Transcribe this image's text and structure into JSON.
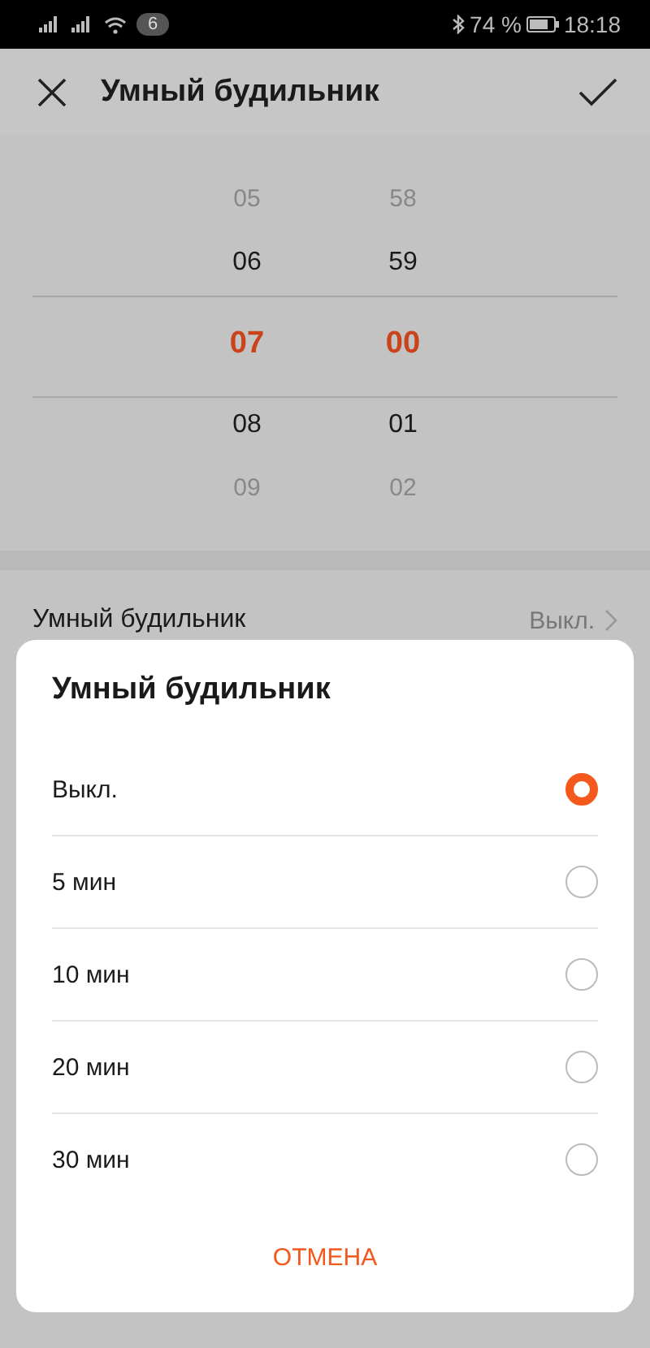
{
  "status_bar": {
    "notifications": "6",
    "battery": "74 %",
    "time": "18:18"
  },
  "header": {
    "title": "Умный будильник"
  },
  "picker": {
    "columns": [
      {
        "items": [
          {
            "text": "05",
            "selected": false,
            "faded": true
          },
          {
            "text": "06",
            "selected": false,
            "faded": false
          },
          {
            "text": "07",
            "selected": true,
            "faded": false
          },
          {
            "text": "08",
            "selected": false,
            "faded": false
          },
          {
            "text": "09",
            "selected": false,
            "faded": true
          }
        ]
      },
      {
        "items": [
          {
            "text": "58",
            "selected": false,
            "faded": true
          },
          {
            "text": "59",
            "selected": false,
            "faded": false
          },
          {
            "text": "00",
            "selected": true,
            "faded": false
          },
          {
            "text": "01",
            "selected": false,
            "faded": false
          },
          {
            "text": "02",
            "selected": false,
            "faded": true
          }
        ]
      }
    ]
  },
  "setting": {
    "label": "Умный будильник",
    "value": "Выкл."
  },
  "dialog": {
    "title": "Умный будильник",
    "options": [
      {
        "label": "Выкл.",
        "selected": true
      },
      {
        "label": "5 мин",
        "selected": false
      },
      {
        "label": "10 мин",
        "selected": false
      },
      {
        "label": "20 мин",
        "selected": false
      },
      {
        "label": "30 мин",
        "selected": false
      }
    ],
    "cancel": "ОТМЕНА"
  }
}
